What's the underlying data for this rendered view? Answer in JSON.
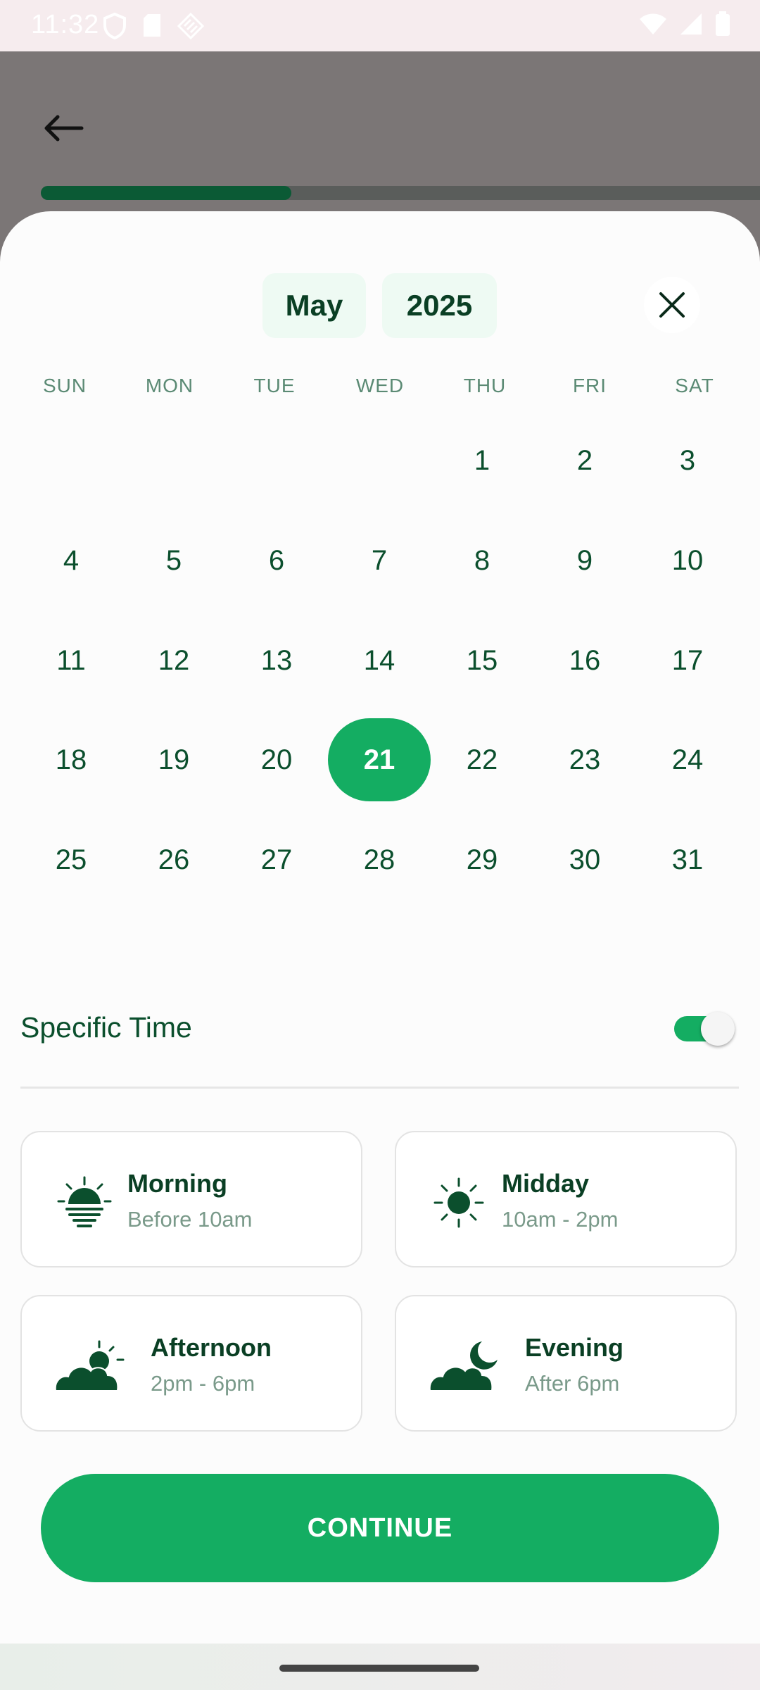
{
  "status_bar": {
    "time": "11:32"
  },
  "calendar": {
    "month": "May",
    "year": "2025",
    "weekdays": [
      "SUN",
      "MON",
      "TUE",
      "WED",
      "THU",
      "FRI",
      "SAT"
    ],
    "days": [
      "1",
      "2",
      "3",
      "4",
      "5",
      "6",
      "7",
      "8",
      "9",
      "10",
      "11",
      "12",
      "13",
      "14",
      "15",
      "16",
      "17",
      "18",
      "19",
      "20",
      "21",
      "22",
      "23",
      "24",
      "25",
      "26",
      "27",
      "28",
      "29",
      "30",
      "31"
    ],
    "selected_day": "21"
  },
  "progress": {
    "fraction": 0.32
  },
  "specific_time": {
    "label": "Specific Time",
    "enabled": true
  },
  "time_options": [
    {
      "icon": "sunrise-icon",
      "title": "Morning",
      "subtitle": "Before 10am"
    },
    {
      "icon": "sun-icon",
      "title": "Midday",
      "subtitle": "10am - 2pm"
    },
    {
      "icon": "partly-cloudy-day-icon",
      "title": "Afternoon",
      "subtitle": "2pm - 6pm"
    },
    {
      "icon": "cloudy-night-icon",
      "title": "Evening",
      "subtitle": "After 6pm"
    }
  ],
  "continue_label": "CONTINUE",
  "colors": {
    "accent": "#14ad62",
    "dark_green": "#0b4f2d"
  }
}
